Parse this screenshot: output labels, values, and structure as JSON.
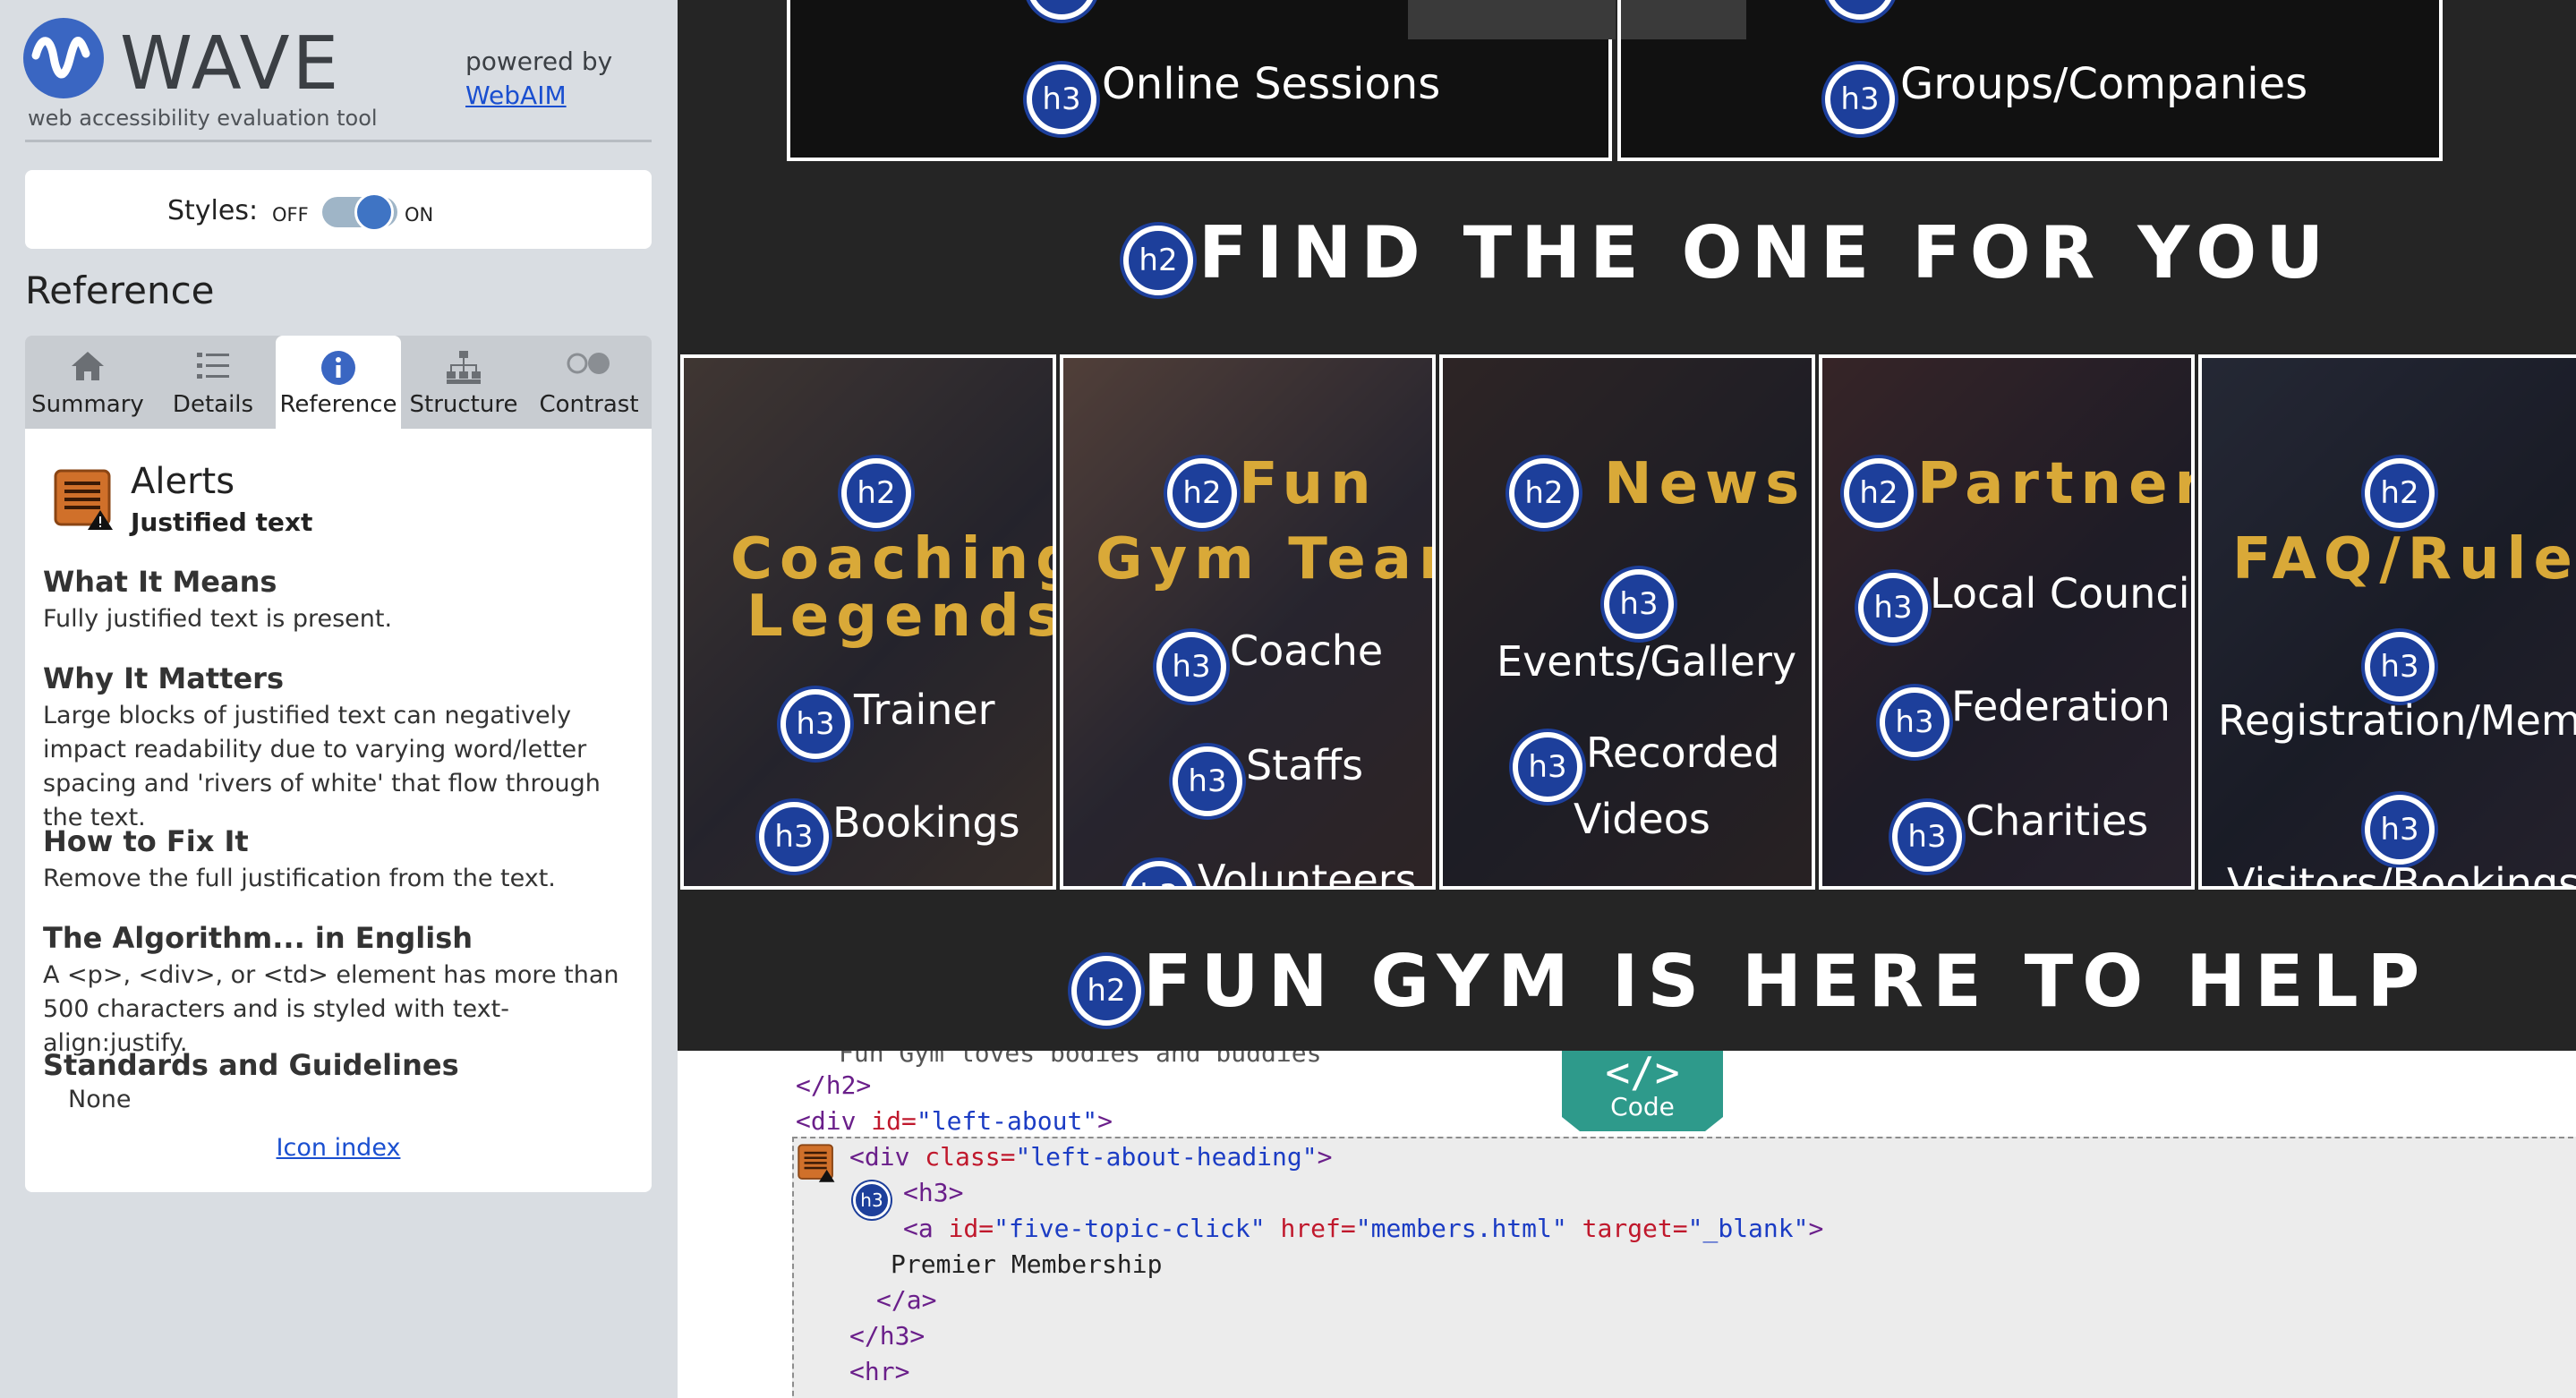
{
  "sidebar": {
    "brand": "WAVE",
    "tagline": "web accessibility evaluation tool",
    "powered_by": "powered by",
    "powered_link": "WebAIM",
    "styles_label": "Styles:",
    "toggle_off": "OFF",
    "toggle_on": "ON",
    "reference_title": "Reference",
    "tabs": [
      {
        "label": "Summary",
        "icon": "home-icon"
      },
      {
        "label": "Details",
        "icon": "list-icon"
      },
      {
        "label": "Reference",
        "icon": "info-icon"
      },
      {
        "label": "Structure",
        "icon": "hierarchy-icon"
      },
      {
        "label": "Contrast",
        "icon": "contrast-icon"
      }
    ],
    "active_tab": "Reference",
    "alert_title": "Alerts",
    "alert_subtitle": "Justified text",
    "sections": [
      {
        "heading": "What It Means",
        "text": "Fully justified text is present."
      },
      {
        "heading": "Why It Matters",
        "text": "Large blocks of justified text can negatively impact readability due to varying word/letter spacing and 'rivers of white' that flow through the text."
      },
      {
        "heading": "How to Fix It",
        "text": "Remove the full justification from the text."
      },
      {
        "heading": "The Algorithm... in English",
        "text": "A <p>, <div>, or <td> element has more than 500 characters and is styled with text-align:justify."
      },
      {
        "heading": "Standards and Guidelines",
        "text": ""
      }
    ],
    "standards_value": "None",
    "icon_index": "Icon index"
  },
  "preview": {
    "top_cards": [
      "Online Sessions",
      "Groups/Companies"
    ],
    "heading_find": "FIND THE ONE FOR YOU",
    "tiles": [
      {
        "title": "Coaching Legends",
        "items": [
          "Trainer",
          "Bookings"
        ]
      },
      {
        "title": "Fun Gym Team",
        "items": [
          "Coache",
          "Staffs",
          "Volunteers"
        ]
      },
      {
        "title": "News",
        "items": [
          "Events/Gallery",
          "Recorded Videos"
        ]
      },
      {
        "title": "Partners",
        "items": [
          "Local Council",
          "Federation",
          "Charities"
        ]
      },
      {
        "title": "FAQ/Rules",
        "items": [
          "Registration/Memb",
          "Visitors/Bookings"
        ]
      }
    ],
    "heading_help": "FUN GYM IS HERE TO HELP",
    "badges": {
      "h2": "h2",
      "h3": "h3"
    }
  },
  "code": {
    "tab_label": "Code",
    "faded_line": "Fun Gym loves bodies and buddies",
    "lines": {
      "h2_close": "</h2>",
      "div_open_a": "<div ",
      "id_attr": "id=",
      "left_about": "\"left-about\"",
      "gt": ">",
      "class_attr": "class=",
      "left_about_heading": "\"left-about-heading\"",
      "h3_open": "<h3>",
      "a_open": "<a ",
      "a_id_val": "\"five-topic-click\"",
      "href_attr": " href=",
      "href_val": "\"members.html\"",
      "target_attr": " target=",
      "target_val": "\"_blank\"",
      "link_text": "Premier Membership",
      "a_close": "</a>",
      "h3_close": "</h3>",
      "hr": "<hr>"
    }
  },
  "colors": {
    "accent": "#3f74c4",
    "badge_blue": "#1d3f9b",
    "gold": "#d9a938",
    "alert_orange": "#d0702a",
    "code_teal": "#2e9a8b"
  }
}
